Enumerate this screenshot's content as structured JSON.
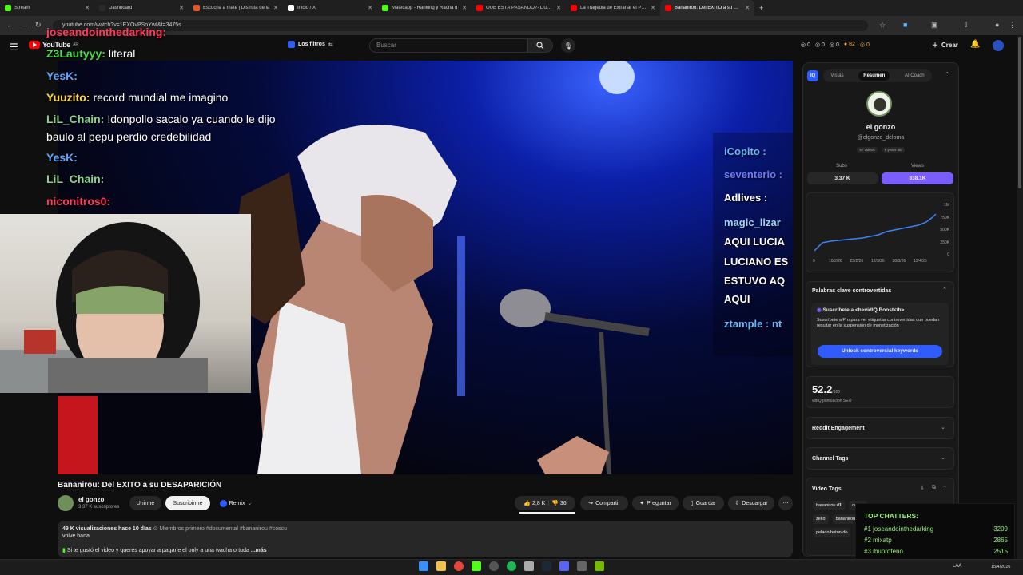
{
  "browser": {
    "tabs": [
      {
        "label": "Stream",
        "color": "#53fc18"
      },
      {
        "label": "Dashboard",
        "color": "#2b2b2b"
      },
      {
        "label": "Escucha a mate | Disfruta de la",
        "color": "#e05a2b"
      },
      {
        "label": "Inicio / X",
        "color": "#ffffff"
      },
      {
        "label": "Matecapp - Ranking y Racha d",
        "color": "#53fc18"
      },
      {
        "label": "QUÉ ESTÁ PASANDO?- DUENDE",
        "color": "#ff0000"
      },
      {
        "label": "La Tragedia de Extrañar el Pres",
        "color": "#ff0000"
      },
      {
        "label": "Bananirou: Del EXITO a su DES",
        "color": "#ff0000",
        "active": true
      }
    ],
    "url": "youtube.com/watch?v=1EXOvPSoYwI&t=3475s"
  },
  "youtube": {
    "logo": "YouTube",
    "logo_sup": "AR",
    "filters": "Los filtros",
    "search_placeholder": "Buscar",
    "create": "Crear",
    "vidiq_toolbar": [
      "0",
      "0",
      "0",
      "82",
      "0"
    ]
  },
  "stream_chat": [
    {
      "user": "joseandointhedarking:",
      "msg": "",
      "color": "#ff3a5a"
    },
    {
      "user": "Z3Lautyyy:",
      "msg": "literal",
      "color": "#4cd94c"
    },
    {
      "user": "YesK:",
      "msg": "",
      "color": "#5fa8ff"
    },
    {
      "user": "Yuuzito:",
      "msg": "record mundial me imagino",
      "color": "#ffd93a"
    },
    {
      "user": "LiL_Chain:",
      "msg": "!donpollo sacalo ya cuando le dijo",
      "color": "#8fd18f"
    },
    {
      "user": "",
      "msg": "baulo al pepu perdio credebilidad",
      "color": "#ffffff"
    },
    {
      "user": "YesK:",
      "msg": "",
      "color": "#5fa8ff"
    },
    {
      "user": "LiL_Chain:",
      "msg": "",
      "color": "#8fd18f"
    },
    {
      "user": "niconitros0:",
      "msg": "",
      "color": "#ff3a5a"
    }
  ],
  "video_overlay_chat": [
    {
      "text": "iCopito :",
      "color": "#6ab8ff"
    },
    {
      "text": "seventerio :",
      "color": "#6a7bff"
    },
    {
      "text": "Adlives :",
      "color": "#ffffff"
    },
    {
      "text": "magic_lizar",
      "color": "#9bd4ff"
    },
    {
      "text": "AQUI LUCIA",
      "color": "#ffffff"
    },
    {
      "text": "LUCIANO ES",
      "color": "#ffffff"
    },
    {
      "text": "ESTUVO AQ",
      "color": "#ffffff"
    },
    {
      "text": "AQUI",
      "color": "#ffffff"
    },
    {
      "text": "ztample : nt",
      "color": "#6ab8ff"
    }
  ],
  "video": {
    "title": "Bananirou: Del EXITO a su DESAPARICIÓN",
    "channel": "el gonzo",
    "subscribers": "3,37 K suscriptores",
    "join": "Unirme",
    "subscribe": "Suscribirme",
    "remix": "Remix",
    "likes": "2,8 K",
    "dislikes": "36",
    "share": "Compartir",
    "ask": "Preguntar",
    "save": "Guardar",
    "download": "Descargar",
    "desc_meta": "49 K visualizaciones  hace 10 días",
    "desc_members": "Miembros primero",
    "desc_tags": "#documental #bananirou #coscu",
    "desc_line1": "volve bana",
    "desc_line2": "Si te gustó el video y querés apoyar a pagarle el only a una wacha ortuda",
    "desc_more": "...más"
  },
  "vidiq": {
    "tabs": [
      "Vistas",
      "Resumen",
      "AI Coach"
    ],
    "active_tab": "Resumen",
    "channel_name": "el gonzo",
    "channel_handle": "@elgonzo_deloma",
    "videos_count": "97 videos",
    "years_old": "9 years old",
    "subs_label": "Subs",
    "subs_value": "3,37 K",
    "views_label": "Views",
    "views_value": "838.1K",
    "chart_y": [
      "1M",
      "750K",
      "500K",
      "250K",
      "0"
    ],
    "chart_x": [
      "0",
      "10/2/26",
      "25/2/26",
      "12/3/26",
      "28/3/26",
      "12/4/26"
    ],
    "keywords_title": "Palabras clave controvertidas",
    "boost_title": "Suscríbete a <b>vidIQ Boost</b>",
    "boost_text": "Suscríbete a Pro para ver etiquetas controvertidas que puedan resultar en la suspensión de monetización",
    "unlock_btn": "Unlock controversial keywords",
    "seo_score": "52.2",
    "seo_max": "/100",
    "seo_label": "vidIQ puntuación SEO",
    "reddit": "Reddit Engagement",
    "channel_tags": "Channel Tags",
    "video_tags": "Video Tags",
    "tags": [
      "bananirou",
      "#1",
      "coscu",
      "zeko",
      "bananirou docu",
      "pelado boton do"
    ]
  },
  "top_chatters": {
    "title": "TOP CHATTERS:",
    "rows": [
      {
        "name": "#1 joseandointhedarking",
        "count": "3209"
      },
      {
        "name": "#2 mixatp",
        "count": "2865"
      },
      {
        "name": "#3 ibuprofeno",
        "count": "2515"
      }
    ]
  },
  "taskbar": {
    "lang": "LAA",
    "date": "15/4/2026"
  }
}
